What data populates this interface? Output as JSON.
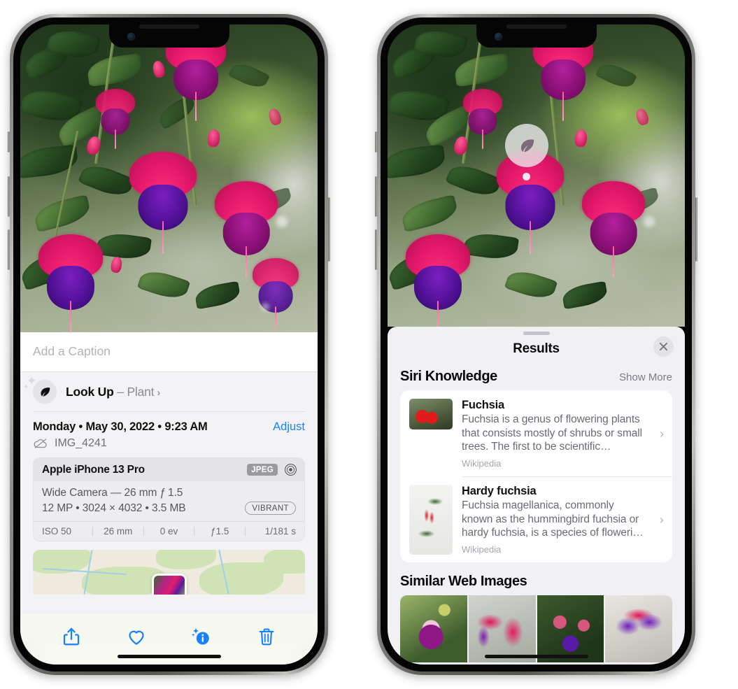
{
  "left_phone": {
    "caption_placeholder": "Add a Caption",
    "lookup": {
      "icon": "leaf-icon",
      "label": "Look Up",
      "dash": " – ",
      "subject": "Plant",
      "chevron": "›"
    },
    "date_line": "Monday • May 30, 2022 • 9:23 AM",
    "adjust_label": "Adjust",
    "filename": "IMG_4241",
    "cloud_icon": "icloud-slash-icon",
    "metadata": {
      "device": "Apple iPhone 13 Pro",
      "format_badge": "JPEG",
      "aperture_icon": "aperture-icon",
      "lens_line": "Wide Camera — 26 mm ƒ 1.5",
      "spec_line": "12 MP • 3024 × 4032 • 3.5 MB",
      "style_badge": "VIBRANT",
      "exif": [
        {
          "label": "ISO 50"
        },
        {
          "label": "26 mm"
        },
        {
          "label": "0 ev"
        },
        {
          "label": "ƒ1.5"
        },
        {
          "label": "1/181 s"
        }
      ]
    },
    "toolbar": [
      {
        "name": "share-icon",
        "label": "Share"
      },
      {
        "name": "heart-icon",
        "label": "Favorite"
      },
      {
        "name": "info-sparkle-icon",
        "label": "Info"
      },
      {
        "name": "trash-icon",
        "label": "Delete"
      }
    ]
  },
  "right_phone": {
    "image_badge_icon": "leaf-icon",
    "results": {
      "title": "Results",
      "close_icon": "close-icon",
      "sections": [
        {
          "title": "Siri Knowledge",
          "action": "Show More",
          "items": [
            {
              "title": "Fuchsia",
              "description": "Fuchsia is a genus of flowering plants that consists mostly of shrubs or small trees. The first to be scientific…",
              "source": "Wikipedia",
              "chevron": "›"
            },
            {
              "title": "Hardy fuchsia",
              "description": "Fuchsia magellanica, commonly known as the hummingbird fuchsia or hardy fuchsia, is a species of floweri…",
              "source": "Wikipedia",
              "chevron": "›"
            }
          ]
        },
        {
          "title": "Similar Web Images",
          "items": [
            {
              "alt": "fuchsia-web-image-1"
            },
            {
              "alt": "fuchsia-web-image-2"
            },
            {
              "alt": "fuchsia-web-image-3"
            },
            {
              "alt": "fuchsia-web-image-4"
            }
          ]
        }
      ]
    }
  },
  "colors": {
    "accent_blue": "#1782ff",
    "sheet_bg": "#f3f3f6",
    "results_bg": "#f1f1f5",
    "card_white": "#ffffff",
    "secondary_text": "#6b6b73",
    "badge_gray": "#9a9aa0"
  }
}
